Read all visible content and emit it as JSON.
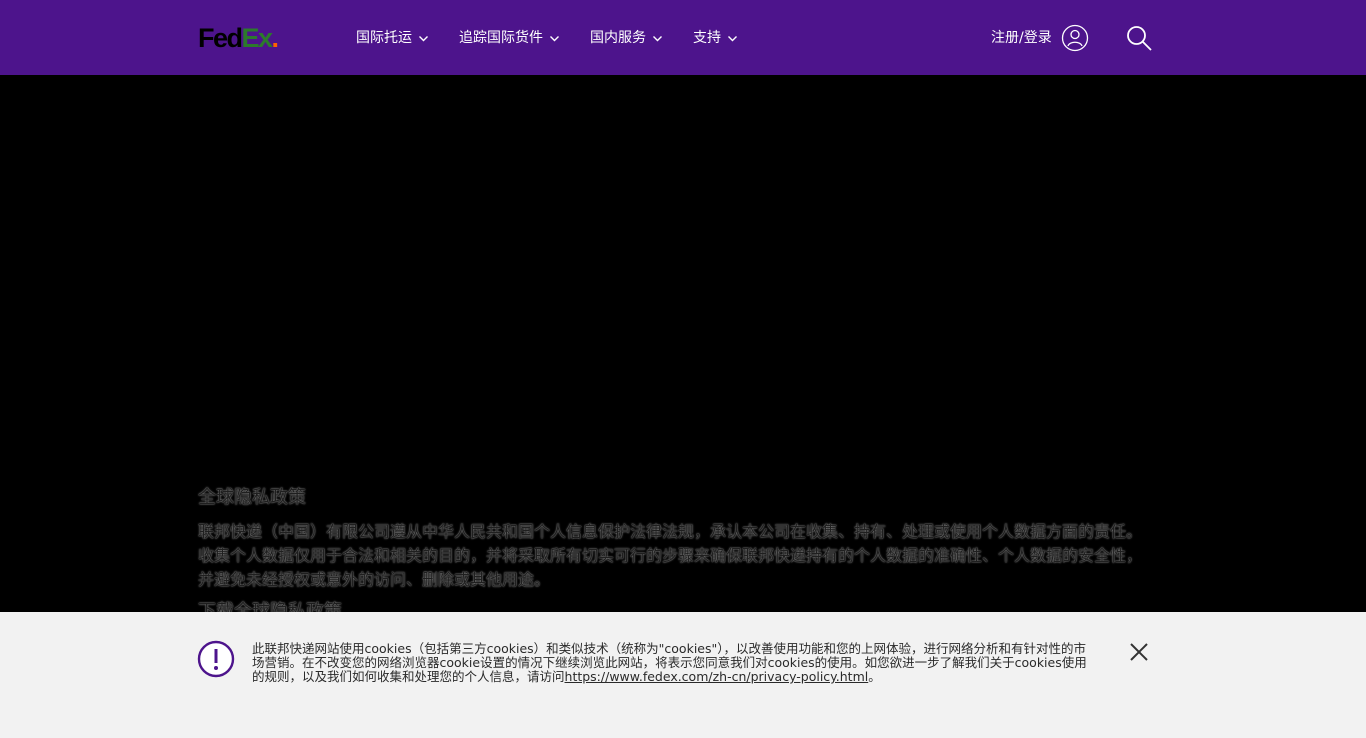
{
  "brand": {
    "fed": "Fed",
    "ex": "Ex",
    "dot": "."
  },
  "colors": {
    "header_bg": "#4d148c",
    "brand_purple": "#4d148c",
    "brand_green": "#2c7a2c",
    "brand_orange": "#ff6200"
  },
  "nav": {
    "items": [
      {
        "label": "国际托运",
        "icon": "chevron-down-icon"
      },
      {
        "label": "追踪国际货件",
        "icon": "chevron-down-icon"
      },
      {
        "label": "国内服务",
        "icon": "chevron-down-icon"
      },
      {
        "label": "支持",
        "icon": "chevron-down-icon"
      }
    ]
  },
  "header": {
    "login_label": "注册/登录",
    "user_icon": "user-icon",
    "search_icon": "search-icon"
  },
  "content": {
    "title": "全球隐私政策",
    "body": "联邦快递（中国）有限公司遵从中华人民共和国个人信息保护法律法规，承认本公司在收集、持有、处理或使用个人数据方面的责任。收集个人数据仅用于合法和相关的目的，并将采取所有切实可行的步骤来确保联邦快递持有的个人数据的准确性、个人数据的安全性，并避免未经授权或意外的访问、删除或其他用途。",
    "subtitle": "下载全球隐私政策"
  },
  "cookie_banner": {
    "icon": "alert-icon",
    "text": "此联邦快递网站使用cookies（包括第三方cookies）和类似技术（统称为\"cookies\"），以改善使用功能和您的上网体验，进行网络分析和有针对性的市场营销。在不改变您的网络浏览器cookie设置的情况下继续浏览此网站，将表示您同意我们对cookies的使用。如您欲进一步了解我们关于cookies使用的规则，以及我们如何收集和处理您的个人信息，请访问",
    "link": "https://www.fedex.com/zh-cn/privacy-policy.html",
    "suffix": "。",
    "close_icon": "close-icon"
  }
}
